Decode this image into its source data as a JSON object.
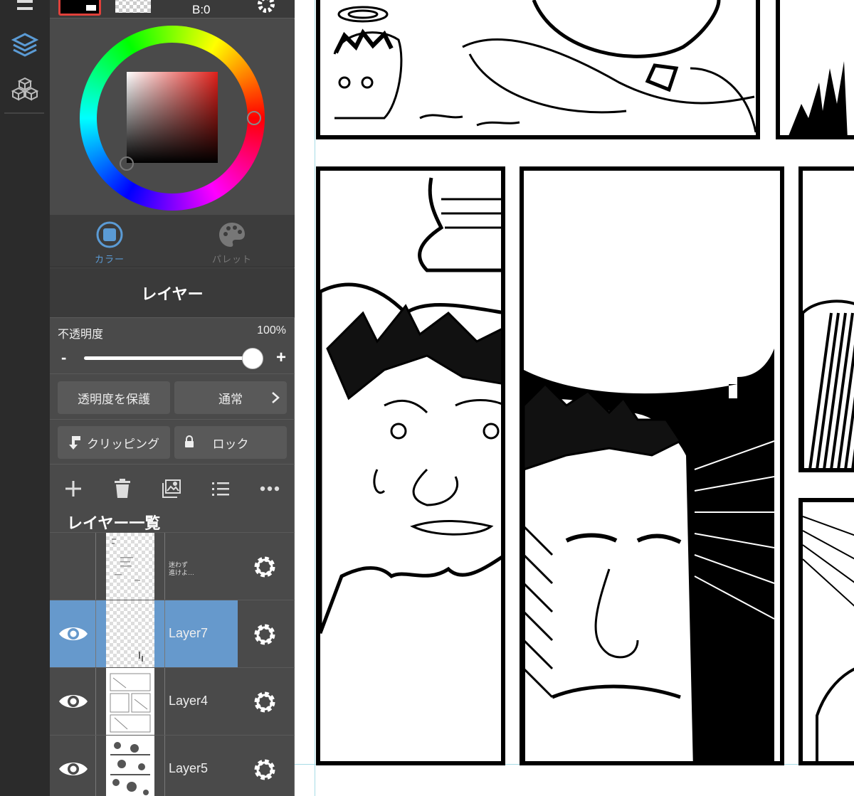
{
  "color_panel": {
    "value_readout": "B:0",
    "tabs": [
      {
        "label": "カラー",
        "icon": "color-square-icon",
        "active": true
      },
      {
        "label": "パレット",
        "icon": "palette-icon",
        "active": false
      }
    ],
    "foreground": "#000000",
    "hue": "#e0201a"
  },
  "layer_panel": {
    "title": "レイヤー",
    "opacity": {
      "label": "不透明度",
      "value": "100%",
      "minus": "-",
      "plus": "+",
      "level": 1.0
    },
    "protect_alpha_label": "透明度を保護",
    "blend_mode": "通常",
    "clipping_label": "クリッピング",
    "lock_label": "ロック",
    "list_title": "レイヤー一覧",
    "toolbar": [
      "add-icon",
      "trash-icon",
      "image-icon",
      "list-icon",
      "more-icon"
    ],
    "layers": [
      {
        "name": "迷わず\n進けよ…",
        "visible": false,
        "active": false
      },
      {
        "name": "Layer7",
        "visible": true,
        "active": true
      },
      {
        "name": "Layer4",
        "visible": true,
        "active": false
      },
      {
        "name": "Layer5",
        "visible": true,
        "active": false
      }
    ]
  },
  "colors": {
    "panel_bg": "#4a4a4a",
    "selected_layer": "#6699cc",
    "accent_blue": "#5b9bd5"
  }
}
